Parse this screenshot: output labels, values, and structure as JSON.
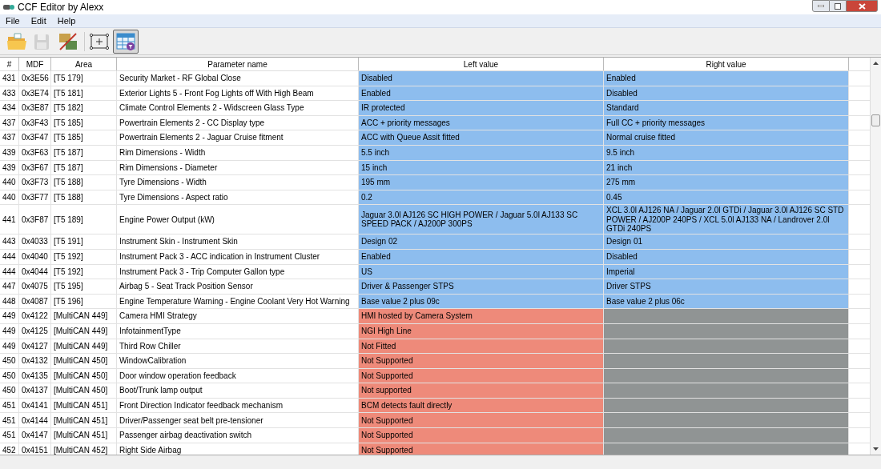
{
  "window": {
    "title": "CCF Editor by Alexx"
  },
  "menu": [
    "File",
    "Edit",
    "Help"
  ],
  "toolbar": [
    {
      "kind": "open",
      "disabled": false,
      "pressed": false
    },
    {
      "kind": "save",
      "disabled": true,
      "pressed": false
    },
    {
      "kind": "compare",
      "disabled": false,
      "pressed": false
    },
    {
      "kind": "fit",
      "disabled": false,
      "pressed": false
    },
    {
      "kind": "filter",
      "disabled": false,
      "pressed": true
    }
  ],
  "table": {
    "columns": [
      "#",
      "MDF",
      "Area",
      "Parameter name",
      "Left value",
      "Right value"
    ],
    "rows": [
      {
        "kind": "differ",
        "cells": [
          "431",
          "0x3E56",
          "[T5 179]",
          "Security Market - RF Global Close",
          "Disabled",
          "Enabled"
        ]
      },
      {
        "kind": "differ",
        "cells": [
          "433",
          "0x3E74",
          "[T5 181]",
          "Exterior Lights 5 - Front Fog Lights off With High Beam",
          "Enabled",
          "Disabled"
        ]
      },
      {
        "kind": "differ",
        "cells": [
          "434",
          "0x3E87",
          "[T5 182]",
          "Climate Control Elements 2 - Widscreen Glass Type",
          "IR protected",
          "Standard"
        ]
      },
      {
        "kind": "differ",
        "cells": [
          "437",
          "0x3F43",
          "[T5 185]",
          "Powertrain Elements 2 - CC Display type",
          "ACC + priority messages",
          "Full CC + priority messages"
        ]
      },
      {
        "kind": "differ",
        "cells": [
          "437",
          "0x3F47",
          "[T5 185]",
          "Powertrain Elements 2 - Jaguar Cruise fitment",
          "ACC with Queue Assit fitted",
          "Normal cruise fitted"
        ]
      },
      {
        "kind": "differ",
        "cells": [
          "439",
          "0x3F63",
          "[T5 187]",
          "Rim Dimensions - Width",
          "5.5 inch",
          "9.5 inch"
        ]
      },
      {
        "kind": "differ",
        "cells": [
          "439",
          "0x3F67",
          "[T5 187]",
          "Rim Dimensions - Diameter",
          "15 inch",
          "21 inch"
        ]
      },
      {
        "kind": "differ",
        "cells": [
          "440",
          "0x3F73",
          "[T5 188]",
          "Tyre Dimensions - Width",
          "195 mm",
          "275 mm"
        ]
      },
      {
        "kind": "differ",
        "cells": [
          "440",
          "0x3F77",
          "[T5 188]",
          "Tyre Dimensions - Aspect ratio",
          "0.2",
          "0.45"
        ]
      },
      {
        "kind": "differ",
        "cells": [
          "441",
          "0x3F87",
          "[T5 189]",
          "Engine Power Output (kW)",
          "Jaguar 3.0l AJ126 SC HIGH POWER / Jaguar 5.0l AJ133 SC SPEED PACK / AJ200P 300PS",
          "XCL 3.0l AJ126 NA / Jaguar 2.0l GTDi / Jaguar 3.0l AJ126 SC STD POWER / AJ200P 240PS / XCL 5.0l AJ133 NA / Landrover 2.0l GTDi 240PS"
        ]
      },
      {
        "kind": "differ",
        "cells": [
          "443",
          "0x4033",
          "[T5 191]",
          "Instrument Skin - Instrument Skin",
          "Design 02",
          "Design 01"
        ]
      },
      {
        "kind": "differ",
        "cells": [
          "444",
          "0x4040",
          "[T5 192]",
          "Instrument Pack 3 - ACC indication in Instrument Cluster",
          "Enabled",
          "Disabled"
        ]
      },
      {
        "kind": "differ",
        "cells": [
          "444",
          "0x4044",
          "[T5 192]",
          "Instrument Pack 3 - Trip Computer Gallon type",
          "US",
          "Imperial"
        ]
      },
      {
        "kind": "differ",
        "cells": [
          "447",
          "0x4075",
          "[T5 195]",
          "Airbag 5 - Seat Track Position Sensor",
          "Driver & Passenger STPS",
          "Driver STPS"
        ]
      },
      {
        "kind": "differ",
        "cells": [
          "448",
          "0x4087",
          "[T5 196]",
          "Engine Temperature Warning - Engine Coolant Very Hot Warning",
          "Base value 2 plus 09c",
          "Base value 2 plus 06c"
        ]
      },
      {
        "kind": "left_only",
        "cells": [
          "449",
          "0x4122",
          "[MultiCAN 449]",
          "Camera HMI Strategy",
          "HMI hosted by Camera System"
        ]
      },
      {
        "kind": "left_only",
        "cells": [
          "449",
          "0x4125",
          "[MultiCAN 449]",
          "InfotainmentType",
          "NGI High Line"
        ]
      },
      {
        "kind": "left_only",
        "cells": [
          "449",
          "0x4127",
          "[MultiCAN 449]",
          "Third Row Chiller",
          "Not Fitted"
        ]
      },
      {
        "kind": "left_only",
        "cells": [
          "450",
          "0x4132",
          "[MultiCAN 450]",
          "WindowCalibration",
          "Not Supported"
        ]
      },
      {
        "kind": "left_only",
        "cells": [
          "450",
          "0x4135",
          "[MultiCAN 450]",
          "Door window operation feedback",
          "Not Supported"
        ]
      },
      {
        "kind": "left_only",
        "cells": [
          "450",
          "0x4137",
          "[MultiCAN 450]",
          "Boot/Trunk lamp output",
          "Not supported"
        ]
      },
      {
        "kind": "left_only",
        "cells": [
          "451",
          "0x4141",
          "[MultiCAN 451]",
          "Front Direction Indicator feedback mechanism",
          "BCM detects fault directly"
        ]
      },
      {
        "kind": "left_only",
        "cells": [
          "451",
          "0x4144",
          "[MultiCAN 451]",
          "Driver/Passenger seat belt pre-tensioner",
          "Not Supported"
        ]
      },
      {
        "kind": "left_only",
        "cells": [
          "451",
          "0x4147",
          "[MultiCAN 451]",
          "Passenger airbag deactivation switch",
          "Not Supported"
        ]
      },
      {
        "kind": "left_only",
        "cells": [
          "452",
          "0x4151",
          "[MultiCAN 452]",
          "Right Side Airbag",
          "Not Supported"
        ]
      }
    ]
  }
}
